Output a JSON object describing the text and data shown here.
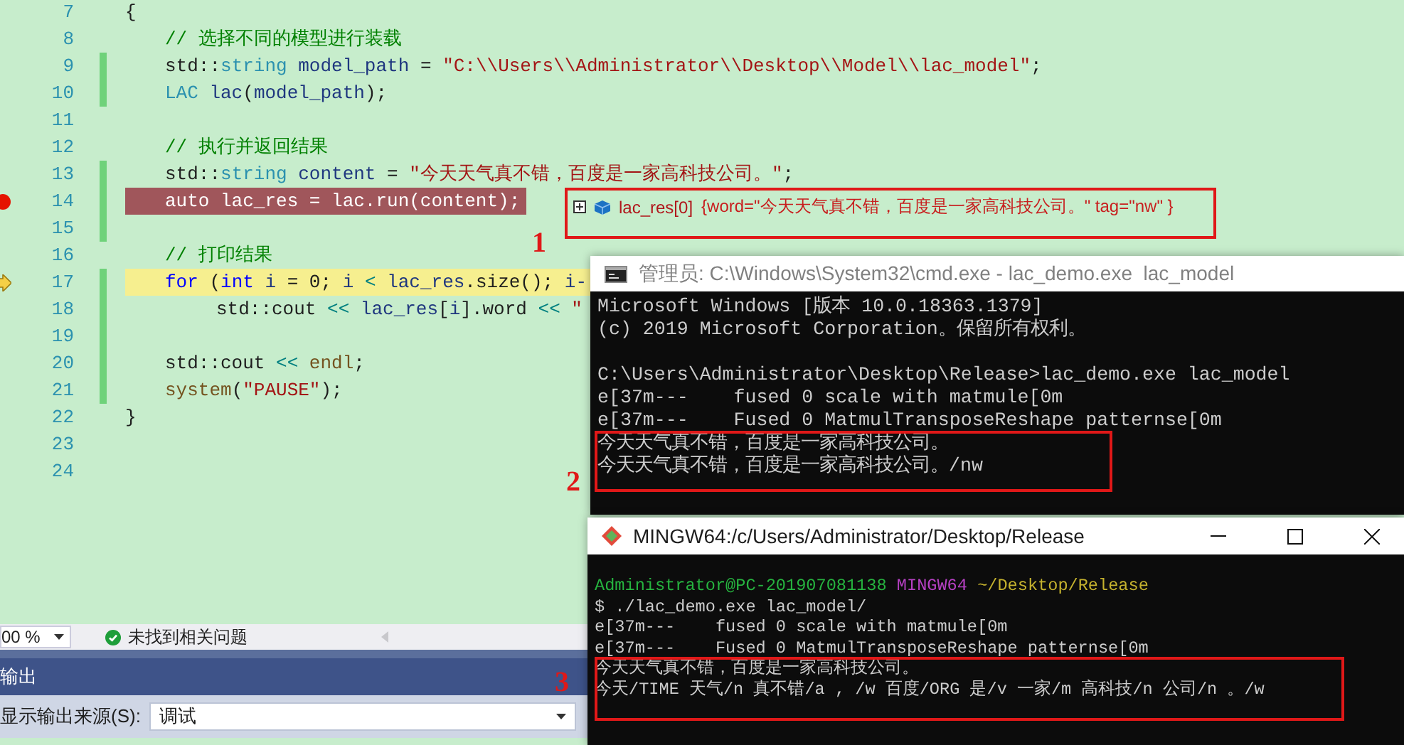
{
  "editor": {
    "lines": [
      {
        "number": "7",
        "kind": "outer",
        "changed": false,
        "breakpoint": false,
        "current": false,
        "tokens": [
          {
            "text": "{",
            "kind": "plain"
          }
        ]
      },
      {
        "number": "8",
        "kind": "inner",
        "changed": false,
        "breakpoint": false,
        "current": false,
        "tokens": [
          {
            "text": "// 选择不同的模型进行装载",
            "kind": "comment"
          }
        ]
      },
      {
        "number": "9",
        "kind": "inner",
        "changed": true,
        "breakpoint": false,
        "current": false,
        "tokens": [
          {
            "text": "std::",
            "kind": "plain"
          },
          {
            "text": "string",
            "kind": "type"
          },
          {
            "text": " model_path",
            "kind": "variable"
          },
          {
            "text": " = ",
            "kind": "plain"
          },
          {
            "text": "\"C:\\\\Users\\\\Administrator\\\\Desktop\\\\Model\\\\lac_model\"",
            "kind": "string"
          },
          {
            "text": ";",
            "kind": "plain"
          }
        ]
      },
      {
        "number": "10",
        "kind": "inner",
        "changed": true,
        "breakpoint": false,
        "current": false,
        "tokens": [
          {
            "text": "LAC",
            "kind": "type"
          },
          {
            "text": " lac",
            "kind": "variable"
          },
          {
            "text": "(",
            "kind": "plain"
          },
          {
            "text": "model_path",
            "kind": "variable"
          },
          {
            "text": ");",
            "kind": "plain"
          }
        ]
      },
      {
        "number": "11",
        "changed": false,
        "breakpoint": false,
        "current": false
      },
      {
        "number": "12",
        "kind": "inner",
        "changed": false,
        "breakpoint": false,
        "current": false,
        "tokens": [
          {
            "text": "// 执行并返回结果",
            "kind": "comment"
          }
        ]
      },
      {
        "number": "13",
        "kind": "inner",
        "changed": true,
        "breakpoint": false,
        "current": false,
        "tokens": [
          {
            "text": "std::",
            "kind": "plain"
          },
          {
            "text": "string",
            "kind": "type"
          },
          {
            "text": " content",
            "kind": "variable"
          },
          {
            "text": " = ",
            "kind": "plain"
          },
          {
            "text": "\"今天天气真不错，百度是一家高科技公司。\"",
            "kind": "string"
          },
          {
            "text": ";",
            "kind": "plain"
          }
        ]
      },
      {
        "number": "14",
        "kind": "inner",
        "changed": true,
        "breakpoint": true,
        "current": false,
        "tokens": [
          {
            "text": "auto lac_res = lac.run(content);",
            "kind": "plain"
          }
        ]
      },
      {
        "number": "15",
        "changed": true,
        "breakpoint": false,
        "current": false
      },
      {
        "number": "16",
        "kind": "inner",
        "changed": false,
        "breakpoint": false,
        "current": false,
        "tokens": [
          {
            "text": "// 打印结果",
            "kind": "comment"
          }
        ]
      },
      {
        "number": "17",
        "kind": "inner",
        "changed": true,
        "breakpoint": false,
        "current": true,
        "tokens": [
          {
            "text": "for",
            "kind": "keyword"
          },
          {
            "text": " (",
            "kind": "plain"
          },
          {
            "text": "int",
            "kind": "keyword"
          },
          {
            "text": " i",
            "kind": "variable"
          },
          {
            "text": " = 0; ",
            "kind": "plain"
          },
          {
            "text": "i",
            "kind": "variable"
          },
          {
            "text": " < ",
            "kind": "operator"
          },
          {
            "text": "lac_res",
            "kind": "variable"
          },
          {
            "text": ".size(); ",
            "kind": "plain"
          },
          {
            "text": "i-",
            "kind": "variable"
          }
        ]
      },
      {
        "number": "18",
        "kind": "deep",
        "changed": true,
        "breakpoint": false,
        "current": false,
        "tokens": [
          {
            "text": "std::cout ",
            "kind": "plain"
          },
          {
            "text": "<< ",
            "kind": "operator"
          },
          {
            "text": "lac_res",
            "kind": "variable"
          },
          {
            "text": "[",
            "kind": "plain"
          },
          {
            "text": "i",
            "kind": "variable"
          },
          {
            "text": "].word ",
            "kind": "plain"
          },
          {
            "text": "<< ",
            "kind": "operator"
          },
          {
            "text": "\"",
            "kind": "string"
          }
        ]
      },
      {
        "number": "19",
        "changed": true,
        "breakpoint": false,
        "current": false
      },
      {
        "number": "20",
        "kind": "inner",
        "changed": true,
        "breakpoint": false,
        "current": false,
        "tokens": [
          {
            "text": "std::cout ",
            "kind": "plain"
          },
          {
            "text": "<< ",
            "kind": "operator"
          },
          {
            "text": "endl",
            "kind": "function"
          },
          {
            "text": ";",
            "kind": "plain"
          }
        ]
      },
      {
        "number": "21",
        "kind": "inner",
        "changed": true,
        "breakpoint": false,
        "current": false,
        "tokens": [
          {
            "text": "system",
            "kind": "function"
          },
          {
            "text": "(",
            "kind": "plain"
          },
          {
            "text": "\"PAUSE\"",
            "kind": "string"
          },
          {
            "text": ");",
            "kind": "plain"
          }
        ]
      },
      {
        "number": "22",
        "kind": "outer",
        "changed": false,
        "breakpoint": false,
        "current": false,
        "tokens": [
          {
            "text": "}",
            "kind": "plain"
          }
        ]
      },
      {
        "number": "23",
        "changed": false,
        "breakpoint": false,
        "current": false
      },
      {
        "number": "24",
        "changed": false,
        "breakpoint": false,
        "current": false
      }
    ]
  },
  "datatip": {
    "name": "lac_res[0]",
    "value": "{word=\"今天天气真不错，百度是一家高科技公司。\" tag=\"nw\" }"
  },
  "status_bar": {
    "zoom": "00 %",
    "issues": "未找到相关问题"
  },
  "output_panel": {
    "title": "输出",
    "source_label": "显示输出来源(S):",
    "source": "调试"
  },
  "cmd_window": {
    "title": "管理员: C:\\Windows\\System32\\cmd.exe - lac_demo.exe  lac_model",
    "blocks": [
      [
        "Microsoft Windows [版本 10.0.18363.1379]",
        "(c) 2019 Microsoft Corporation。保留所有权利。"
      ],
      [
        "C:\\Users\\Administrator\\Desktop\\Release>lac_demo.exe lac_model",
        "e[37m---    fused 0 scale with matmule[0m",
        "e[37m---    Fused 0 MatmulTransposeReshape patternse[0m",
        "今天天气真不错，百度是一家高科技公司。",
        "今天天气真不错，百度是一家高科技公司。/nw"
      ]
    ]
  },
  "mingw_window": {
    "title": "MINGW64:/c/Users/Administrator/Desktop/Release",
    "prompt": {
      "user_host": "Administrator@PC-201907081138",
      "shell": "MINGW64",
      "path": "~/Desktop/Release"
    },
    "lines": [
      "$ ./lac_demo.exe lac_model/",
      "e[37m---    fused 0 scale with matmule[0m",
      "e[37m---    Fused 0 MatmulTransposeReshape patternse[0m",
      "今天天气真不错，百度是一家高科技公司。",
      "今天/TIME 天气/n 真不错/a , /w 百度/ORG 是/v 一家/m 高科技/n 公司/n 。/w"
    ]
  },
  "annotations": [
    {
      "number": "1"
    },
    {
      "number": "2"
    },
    {
      "number": "3"
    }
  ]
}
